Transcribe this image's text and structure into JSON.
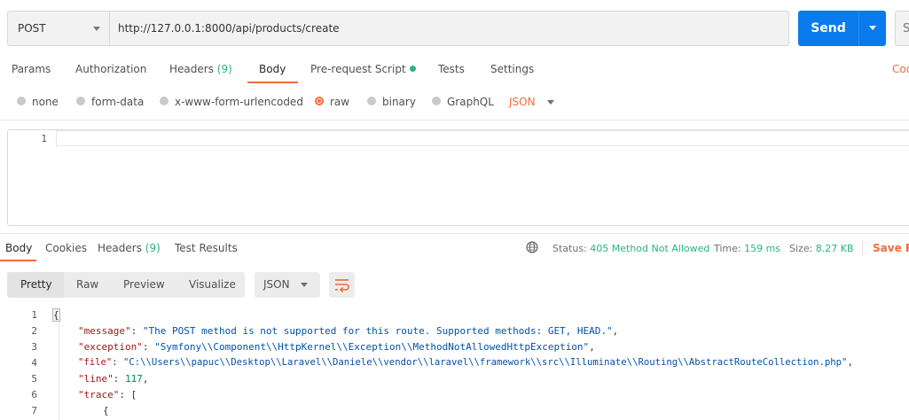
{
  "request": {
    "method": "POST",
    "url": "http://127.0.0.1:8000/api/products/create",
    "send_label": "Send",
    "save_label": "S"
  },
  "request_tabs": [
    {
      "label": "Params"
    },
    {
      "label": "Authorization"
    },
    {
      "label": "Headers",
      "count": "(9)"
    },
    {
      "label": "Body"
    },
    {
      "label": "Pre-request Script"
    },
    {
      "label": "Tests"
    },
    {
      "label": "Settings"
    }
  ],
  "cookies_link": "Coo",
  "body_types": [
    {
      "label": "none"
    },
    {
      "label": "form-data"
    },
    {
      "label": "x-www-form-urlencoded"
    },
    {
      "label": "raw"
    },
    {
      "label": "binary"
    },
    {
      "label": "GraphQL"
    }
  ],
  "raw_format": "JSON",
  "editor": {
    "line_number": "1"
  },
  "response_tabs": [
    {
      "label": "Body"
    },
    {
      "label": "Cookies"
    },
    {
      "label": "Headers",
      "count": "(9)"
    },
    {
      "label": "Test Results"
    }
  ],
  "response_meta": {
    "status_label": "Status:",
    "status_value": "405 Method Not Allowed",
    "time_label": "Time:",
    "time_value": "159 ms",
    "size_label": "Size:",
    "size_value": "8.27 KB",
    "save_response": "Save Re"
  },
  "view_modes": [
    {
      "label": "Pretty"
    },
    {
      "label": "Raw"
    },
    {
      "label": "Preview"
    },
    {
      "label": "Visualize"
    }
  ],
  "response_format": "JSON",
  "response_lines": [
    {
      "num": "1",
      "text": "{"
    },
    {
      "num": "2",
      "key": "\"message\"",
      "value": "\"The POST method is not supported for this route. Supported methods: GET, HEAD.\"",
      "type": "str",
      "tail": ","
    },
    {
      "num": "3",
      "key": "\"exception\"",
      "value": "\"Symfony\\\\Component\\\\HttpKernel\\\\Exception\\\\MethodNotAllowedHttpException\"",
      "type": "str",
      "tail": ","
    },
    {
      "num": "4",
      "key": "\"file\"",
      "value": "\"C:\\\\Users\\\\papuc\\\\Desktop\\\\Laravel\\\\Daniele\\\\vendor\\\\laravel\\\\framework\\\\src\\\\Illuminate\\\\Routing\\\\AbstractRouteCollection.php\"",
      "type": "str",
      "tail": ","
    },
    {
      "num": "5",
      "key": "\"line\"",
      "value": "117",
      "type": "num",
      "tail": ","
    },
    {
      "num": "6",
      "key": "\"trace\"",
      "value": "[",
      "type": "punct",
      "tail": ""
    },
    {
      "num": "7",
      "text": "{"
    }
  ]
}
